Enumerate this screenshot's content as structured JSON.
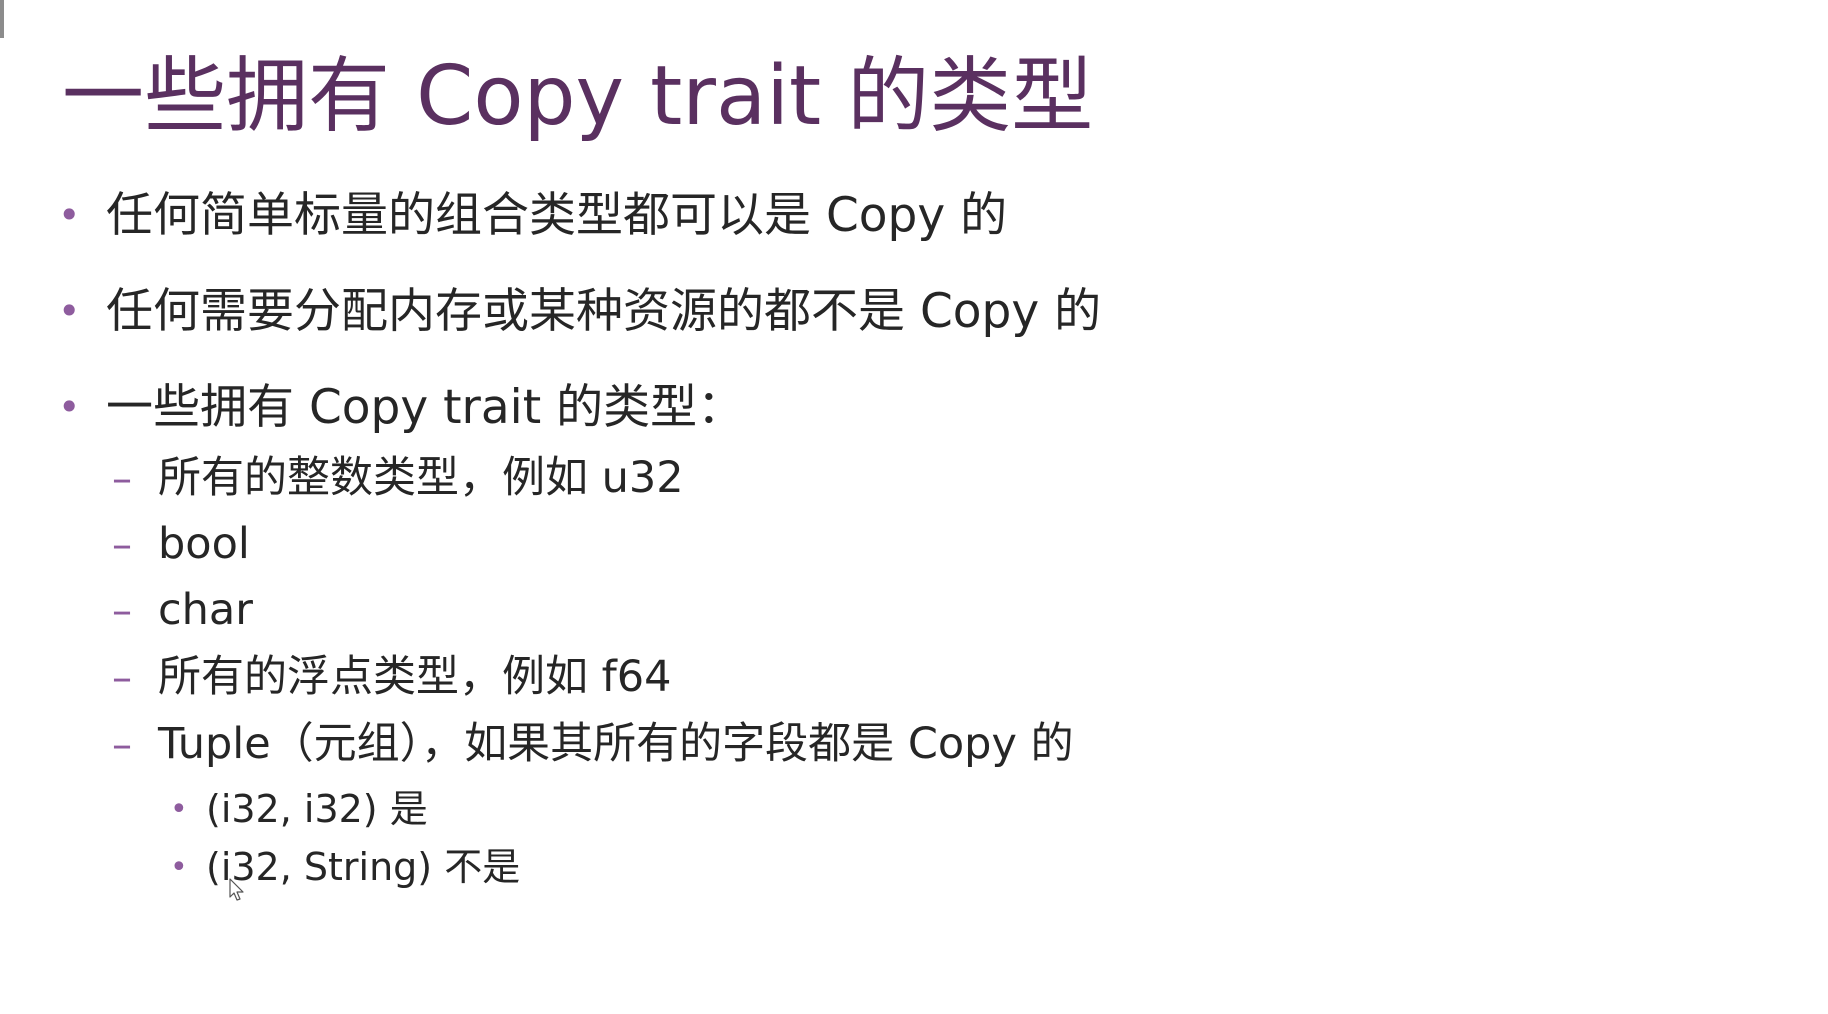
{
  "slide": {
    "title": "一些拥有 Copy trait 的类型",
    "bullets": [
      {
        "marker": "•",
        "text": "任何简单标量的组合类型都可以是 Copy 的"
      },
      {
        "marker": "•",
        "text": "任何需要分配内存或某种资源的都不是 Copy 的"
      },
      {
        "marker": "•",
        "text": "一些拥有 Copy trait 的类型："
      }
    ],
    "sub_bullets": [
      {
        "marker": "–",
        "text": "所有的整数类型，例如 u32"
      },
      {
        "marker": "–",
        "text": "bool"
      },
      {
        "marker": "–",
        "text": "char"
      },
      {
        "marker": "–",
        "text": "所有的浮点类型，例如 f64"
      },
      {
        "marker": "–",
        "text": "Tuple（元组），如果其所有的字段都是 Copy 的"
      }
    ],
    "sub_sub_bullets": [
      {
        "marker": "•",
        "text": "(i32, i32) 是"
      },
      {
        "marker": "•",
        "text": "(i32, String) 不是"
      }
    ]
  },
  "colors": {
    "title": "#5a3060",
    "bullet_marker": "#8e5c9e",
    "body_text": "#262626",
    "background": "#ffffff"
  }
}
